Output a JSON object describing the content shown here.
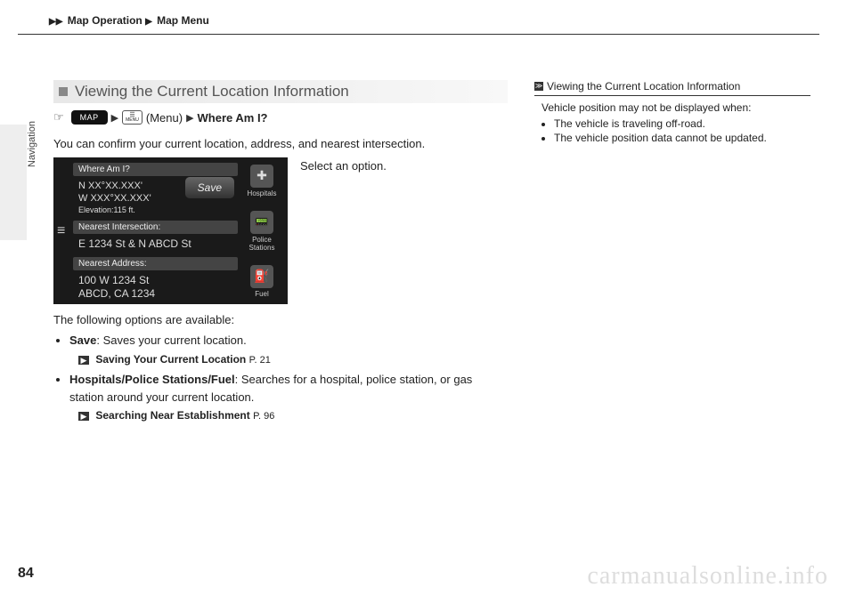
{
  "breadcrumb": {
    "a": "Map Operation",
    "b": "Map Menu"
  },
  "sideLabel": "Navigation",
  "section": {
    "title": "Viewing the Current Location Information",
    "mapBtn": "MAP",
    "menuBtn": "MENU",
    "menuWord": "(Menu)",
    "whereAmI": "Where Am I?",
    "intro": "You can confirm your current location, address, and nearest intersection.",
    "stepText": "Select an option."
  },
  "screenshot": {
    "label1": "Where Am I?",
    "coords1": "N XX°XX.XXX'",
    "coords2": "W XXX°XX.XXX'",
    "elev": "Elevation:115 ft.",
    "saveBtn": "Save",
    "label2": "Nearest Intersection:",
    "intersection": "E 1234 St & N ABCD St",
    "label3": "Nearest Address:",
    "addr1": "100 W 1234 St",
    "addr2": "ABCD, CA 1234",
    "icon1": "Hospitals",
    "icon2": "Police Stations",
    "icon3": "Fuel"
  },
  "options": {
    "intro": "The following options are available:",
    "saveLabel": "Save",
    "saveDesc": ": Saves your current location.",
    "xref1Label": "Saving Your Current Location",
    "xref1Page": "P. 21",
    "hpfLabel": "Hospitals/Police Stations/Fuel",
    "hpfDesc": ": Searches for a hospital, police station, or gas station around your current location.",
    "xref2Label": "Searching Near Establishment",
    "xref2Page": "P. 96"
  },
  "tips": {
    "title": "Viewing the Current Location Information",
    "intro": "Vehicle position may not be displayed when:",
    "b1": "The vehicle is traveling off-road.",
    "b2": "The vehicle position data cannot be updated."
  },
  "pageNum": "84",
  "watermark": "carmanualsonline.info"
}
